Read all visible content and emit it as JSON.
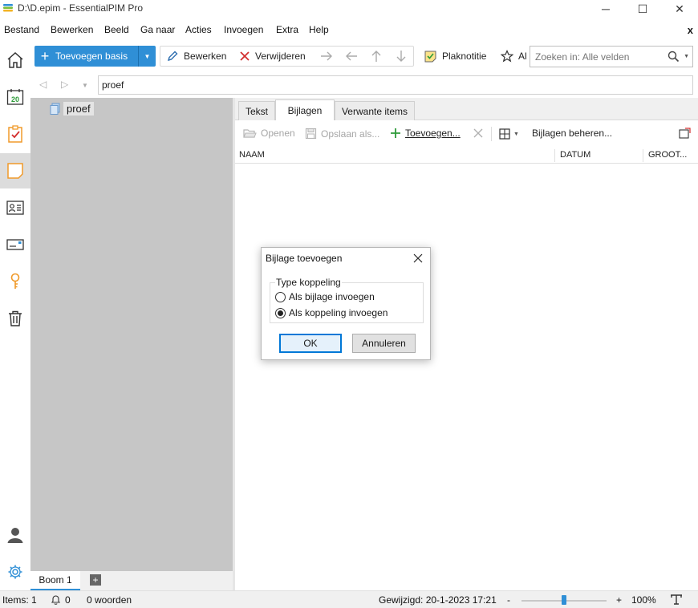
{
  "window": {
    "title": "D:\\D.epim - EssentialPIM Pro",
    "minimize_glyph": "─",
    "maximize_glyph": "☐",
    "close_glyph": "✕"
  },
  "menu": {
    "items": [
      "Bestand",
      "Bewerken",
      "Beeld",
      "Ga naar",
      "Acties",
      "Invoegen",
      "Extra",
      "Help"
    ],
    "close_label": "x"
  },
  "toolbar": {
    "add_label": "Toevoegen basis",
    "edit_label": "Bewerken",
    "delete_label": "Verwijderen",
    "sticky_label": "Plaknotitie",
    "star_label": "Al"
  },
  "search": {
    "placeholder": "Zoeken in: Alle velden"
  },
  "nav": {
    "calendar_day": "20"
  },
  "path": {
    "value": "proef"
  },
  "tree": {
    "node_label": "proef",
    "tab_label": "Boom 1",
    "add_tab_glyph": "+"
  },
  "content": {
    "tabs": [
      "Tekst",
      "Bijlagen",
      "Verwante items"
    ],
    "active_tab": "Bijlagen",
    "subtoolbar": {
      "open_label": "Openen",
      "save_as_label": "Opslaan als...",
      "add_label": "Toevoegen...",
      "manage_label": "Bijlagen beheren..."
    },
    "columns": [
      "NAAM",
      "DATUM",
      "GROOT..."
    ]
  },
  "dialog": {
    "title": "Bijlage toevoegen",
    "group_label": "Type koppeling",
    "options": [
      "Als bijlage invoegen",
      "Als koppeling invoegen"
    ],
    "selected_option": "Als koppeling invoegen",
    "ok_label": "OK",
    "cancel_label": "Annuleren"
  },
  "status": {
    "items": "Items: 1",
    "reminders": "0",
    "words": "0 woorden",
    "modified": "Gewijzigd: 20-1-2023 17:21",
    "zoom_minus": "-",
    "zoom_plus": "+",
    "zoom": "100%",
    "zoom_level": 0.5
  },
  "colors": {
    "accent": "#2f8fd6",
    "tree_background": "#c6c6c6",
    "delete_red": "#d32f2f",
    "add_green": "#2e9b3a",
    "orange_icon": "#f09a2a"
  }
}
